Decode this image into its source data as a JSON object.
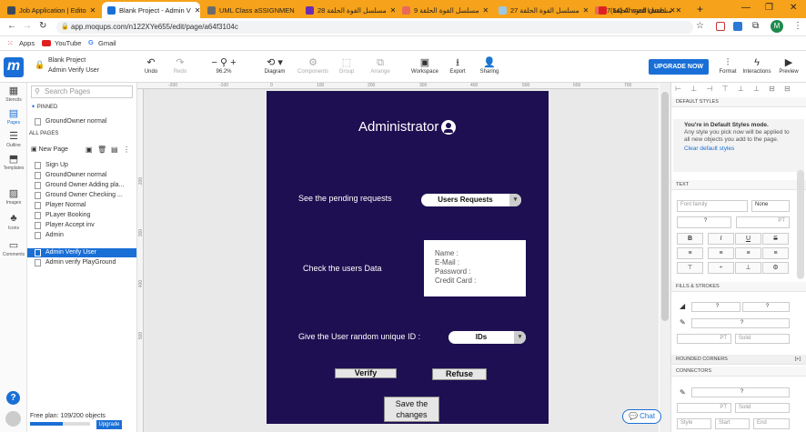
{
  "browser": {
    "tabs": [
      {
        "title": "Job Application | Edito",
        "color": "#3a4a5c"
      },
      {
        "title": "Blank Project - Admin V",
        "color": "#1a6fd6"
      },
      {
        "title": "UML Class aSSIGNMEN",
        "color": "#6b6b6b"
      },
      {
        "title": "مسلسل القوة الحلقة 28",
        "color": "#6a2cb5"
      },
      {
        "title": "مسلسل القوة الحلقة 9",
        "color": "#e86a5a"
      },
      {
        "title": "مسلسل القوة الحلقة 27",
        "color": "#9cc8e8"
      },
      {
        "title": "مسلسل القوة الحلقة 7",
        "color": "#e86a5a"
      },
      {
        "title": "(54) Ahmed kamel",
        "color": "#e02020"
      }
    ],
    "new_tab": "+",
    "url": "app.moqups.com/n122XYe655/edit/page/a64f3104c",
    "profile_initial": "M",
    "bookmarks": [
      "Apps",
      "YouTube",
      "Gmail"
    ]
  },
  "app": {
    "logo": "m",
    "project_name": "Blank Project",
    "page_name": "Admin Verify User",
    "toolbar": {
      "undo": "Undo",
      "redo": "Redo",
      "zoom": "96.2%",
      "diagram": "Diagram",
      "components": "Components",
      "group": "Group",
      "arrange": "Arrange",
      "workspace": "Workspace",
      "export": "Export",
      "sharing": "Sharing",
      "upgrade": "UPGRADE NOW",
      "format": "Format",
      "interactions": "Interactions",
      "preview": "Preview"
    },
    "rail": [
      "Stencils",
      "Pages",
      "Outline",
      "Templates",
      "Images",
      "Icons",
      "Comments"
    ],
    "pages_panel": {
      "search_placeholder": "Search Pages",
      "pinned_label": "PINNED",
      "pinned": [
        "GroundOwner normal"
      ],
      "all_label": "ALL PAGES",
      "new_page": "New Page",
      "pages": [
        "Sign Up",
        "GroundOwner normal",
        "Ground Owner Adding pla...",
        "Ground Owner Checking ...",
        "Player Normal",
        "PLayer Booking",
        "Player Accept inv",
        "Admin",
        "Admin Verify User",
        "Admin verify PlayGround"
      ],
      "selected_index": 8,
      "plan_text": "Free plan: 109/200 objects",
      "plan_progress": 0.545,
      "plan_upgrade": "Upgrade"
    },
    "rulers": {
      "h": [
        "-200",
        "-100",
        "0",
        "100",
        "200",
        "300",
        "400",
        "500",
        "600",
        "700",
        "800"
      ],
      "v": [
        "200",
        "300",
        "400",
        "500"
      ]
    },
    "artboard": {
      "title": "Administrator",
      "pending_label": "See the pending requests",
      "requests_button": "Users Requests",
      "check_label": "Check the users Data",
      "fields": [
        "Name :",
        "E-Mail :",
        "Password :",
        "Credit Card :"
      ],
      "unique_label": "Give the User random unique ID :",
      "ids_button": "IDs",
      "verify": "Verify",
      "refuse": "Refuse",
      "save_line1": "Save the",
      "save_line2": "changes",
      "background": "#1e0f52"
    },
    "right_panel": {
      "default_styles": "DEFAULT STYLES",
      "ds_title": "You're in Default Styles mode.",
      "ds_body": "Any style you pick now will be applied to all new objects you add to the page.",
      "ds_link": "Clear default styles",
      "text": "TEXT",
      "font_placeholder": "Font family",
      "font_style": "None",
      "q": "?",
      "pt": "PT",
      "fills": "FILLS & STROKES",
      "solid": "Solid",
      "rounded": "ROUNDED CORNERS",
      "rounded_toggle": "[+]",
      "connectors": "CONNECTORS",
      "style": "Style",
      "start": "Start",
      "end": "End"
    },
    "chat": "Chat",
    "help": "?"
  }
}
